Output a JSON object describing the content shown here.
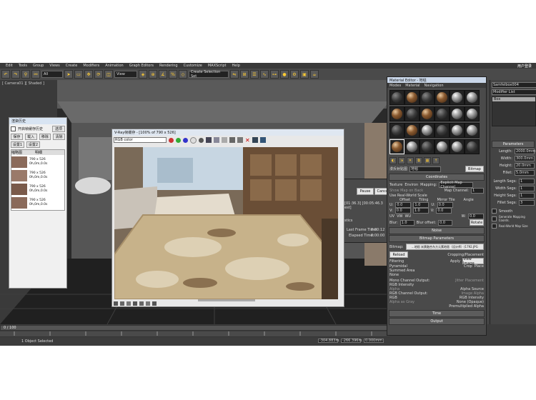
{
  "menu": [
    "Edit",
    "Tools",
    "Group",
    "Views",
    "Create",
    "Modifiers",
    "Animation",
    "Graph Editors",
    "Rendering",
    "Customize",
    "MAXScript",
    "Help"
  ],
  "toolbar": {
    "filter": "All",
    "view": "View",
    "create_selection": "Create Selection Set"
  },
  "login": "用户登录",
  "viewport_label": "[ Camera01 ][ Shaded ]",
  "history": {
    "title": "渲染历史",
    "checkbox": "开启帧缓存历史",
    "option": "选项",
    "buttons": [
      "保存",
      "载入",
      "移除",
      "清除"
    ],
    "buttons2": [
      "设置1",
      "设置2"
    ],
    "col_thumb": "缩略图",
    "col_info": "明细",
    "items": [
      {
        "size": "790 x 526",
        "time": "0h,0m,0.0s"
      },
      {
        "size": "790 x 526",
        "time": "0h,0m,0.0s"
      },
      {
        "size": "790 x 526",
        "time": "0h,0m,0.0s"
      },
      {
        "size": "790 x 526",
        "time": "0h,0m,0.0s"
      }
    ]
  },
  "framebuffer": {
    "title": "V-Ray帧缓存 - [100% of 790 x 526]",
    "channel": "RGB color"
  },
  "progress": {
    "pause": "Pause",
    "cancel": "Cancel",
    "time_text": "[01:36.3] [00:05:46.3 est]",
    "stats": "stics",
    "last_frame_label": "Last Frame Time:",
    "last_frame": "0:00:12",
    "elapsed_label": "Elapsed Time:",
    "elapsed": "0:00:00"
  },
  "material_editor": {
    "title": "Material Editor - 地毯",
    "menus": [
      "Modes",
      "Material",
      "Navigation"
    ],
    "name_label": "漫反射贴图",
    "name": "地毯",
    "map_type": "Bitmap",
    "coords_header": "Coordinates",
    "texture": "Texture",
    "environ": "Environ",
    "mapping_label": "Mapping:",
    "mapping": "Explicit Map Channel",
    "show_map": "Show Map on Back",
    "map_channel": "Map Channel:",
    "map_channel_val": "1",
    "real_world": "Use Real-World Scale",
    "offset": "Offset",
    "tiling": "Tiling",
    "mirror_tile": "Mirror Tile",
    "angle": "Angle",
    "u": "U:",
    "v": "V:",
    "w": "W:",
    "u_vals": [
      "0.0",
      "1.0",
      "0.0"
    ],
    "v_vals": [
      "0.0",
      "1.0",
      "0.0"
    ],
    "w_val": "0.0",
    "uv": "UV",
    "vw": "VW",
    "wu": "WU",
    "blur": "Blur:",
    "blur_val": "1.0",
    "blur_offset": "Blur offset:",
    "blur_offset_val": "0.0",
    "rotate": "Rotate",
    "noise": "Noise",
    "bitmap_params": "Bitmap Parameters",
    "bitmap_label": "Bitmap:",
    "bitmap_path": "...地毯 米黄融合东方元素地毯（设计师）(1792.JPG",
    "reload": "Reload",
    "cropping": "Cropping/Placement",
    "apply": "Apply",
    "view_image": "View Image",
    "crop": "Crop",
    "place": "Place",
    "filtering": "Filtering",
    "pyramidal": "Pyramidal",
    "summed": "Summed Area",
    "none": "None",
    "mono": "Mono Channel Output:",
    "rgb_intensity": "RGB Intensity",
    "alpha": "Alpha",
    "rgb_out": "RGB Channel Output:",
    "rgb": "RGB",
    "alpha_gray": "Alpha as Gray",
    "jitter": "Jitter Placement",
    "alpha_source": "Alpha Source",
    "image_alpha": "Image Alpha",
    "rgb_int2": "RGB Intensity",
    "none_opaque": "None (Opaque)",
    "premult": "Premultiplied Alpha",
    "time": "Time",
    "output": "Output"
  },
  "command_panel": {
    "object": "Samfelbox004",
    "modifier_list": "Modifier List",
    "stack_item": "Box",
    "params": "Parameters",
    "length_label": "Length:",
    "length": "2000.0mm",
    "width_label": "Width:",
    "width": "300.0mm",
    "height_label": "Height:",
    "height": "20.0mm",
    "fillet_label": "Fillet:",
    "fillet": "5.0mm",
    "lsegs_label": "Length Segs:",
    "lsegs": "1",
    "wsegs_label": "Width Segs:",
    "wsegs": "1",
    "hsegs_label": "Height Segs:",
    "hsegs": "1",
    "fsegs_label": "Fillet Segs:",
    "fsegs": "3",
    "smooth": "Smooth",
    "gen_map": "Generate Mapping Coords.",
    "real_world_map": "Real-World Map Size"
  },
  "status": {
    "frame": "0 / 100",
    "selected": "1 Object Selected",
    "x": "-304.883m",
    "y": "-266.396m",
    "z": "0.000mm"
  }
}
